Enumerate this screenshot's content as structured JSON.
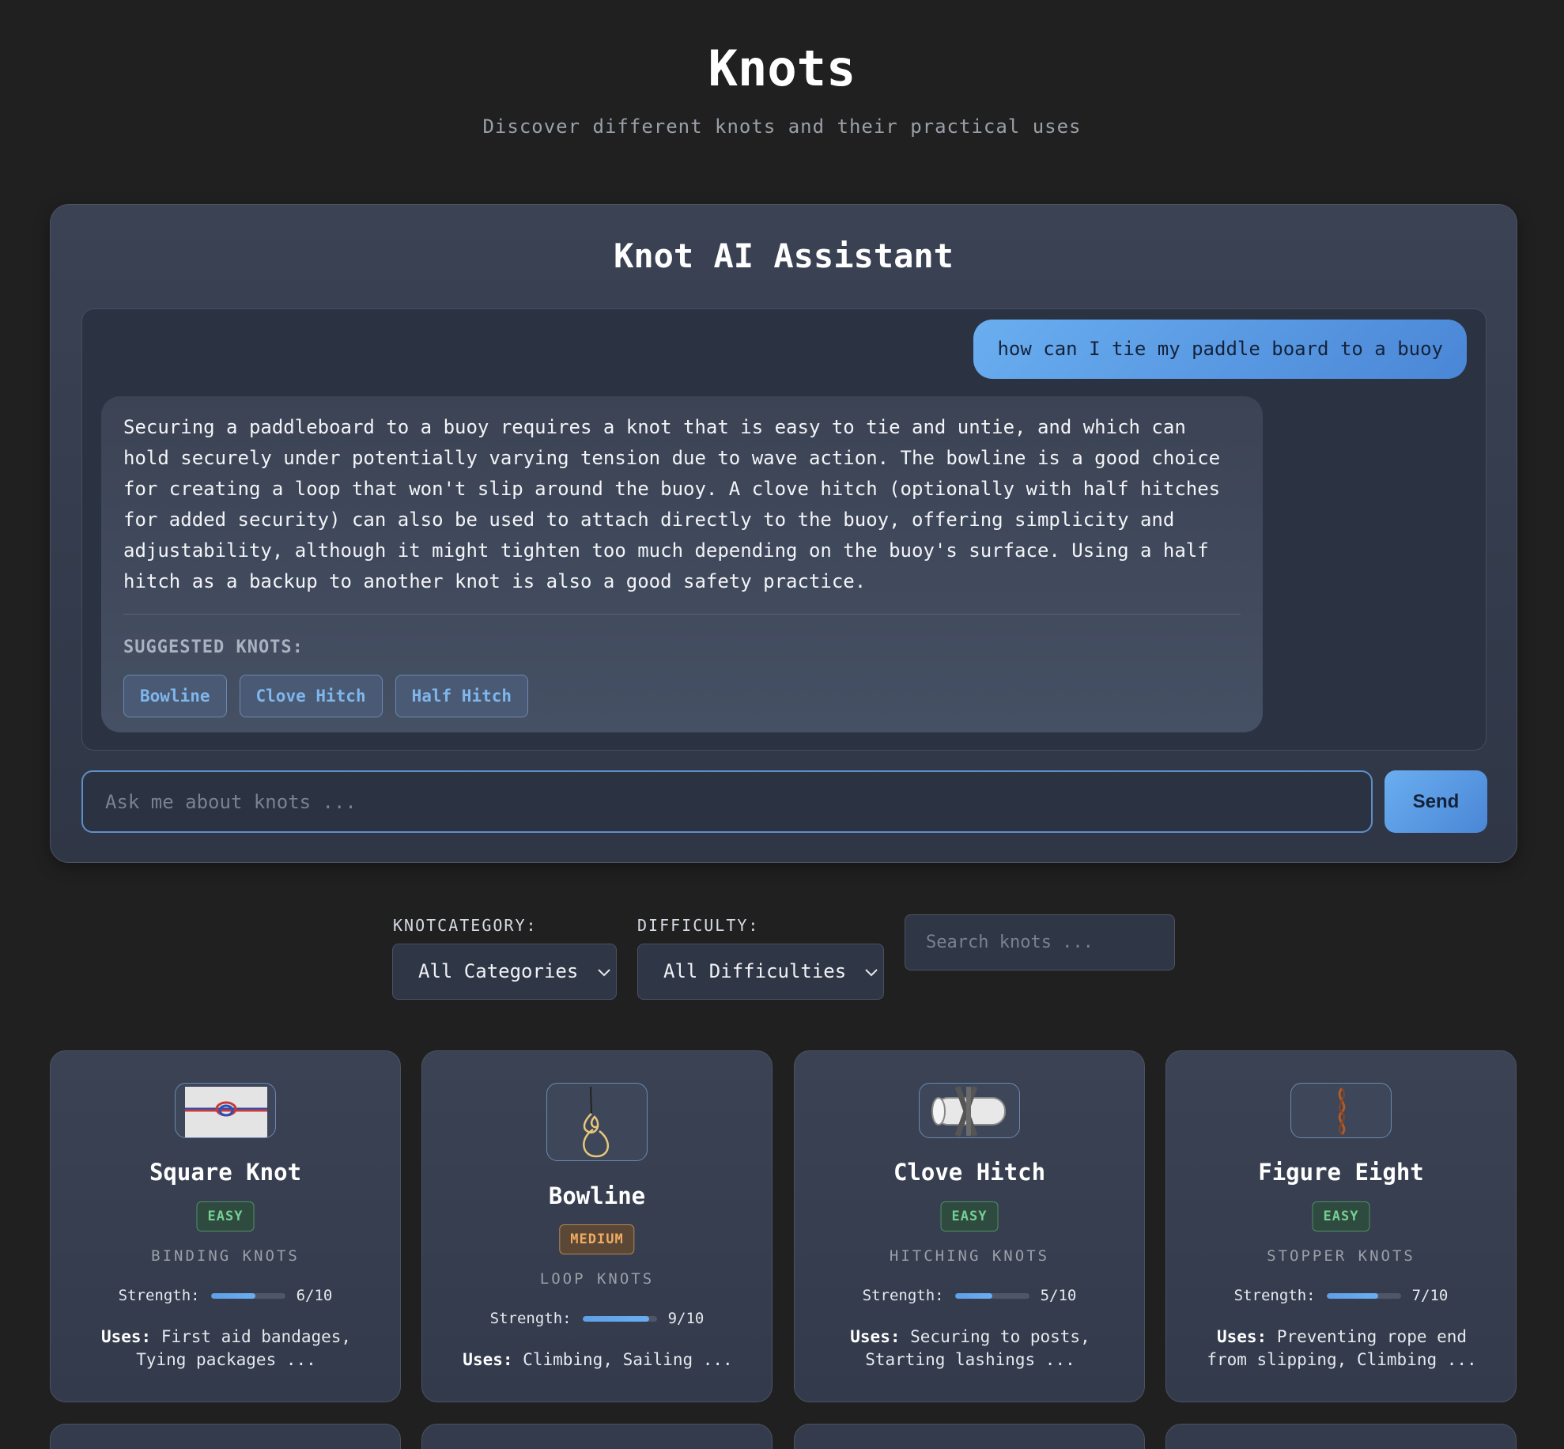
{
  "header": {
    "title": "Knots",
    "subtitle": "Discover different knots and their practical uses"
  },
  "assistant": {
    "title": "Knot AI Assistant",
    "user_message": "how can I tie my paddle board to a buoy",
    "ai_message": "Securing a paddleboard to a buoy requires a knot that is easy to tie and untie, and which can hold securely under potentially varying tension due to wave action. The bowline is a good choice for creating a loop that won't slip around the buoy. A clove hitch (optionally with half hitches for added security) can also be used to attach directly to the buoy, offering simplicity and adjustability, although it might tighten too much depending on the buoy's surface. Using a half hitch as a backup to another knot is also a good safety practice.",
    "suggested_label": "SUGGESTED KNOTS:",
    "suggested_knots": [
      "Bowline",
      "Clove Hitch",
      "Half Hitch"
    ],
    "input_placeholder": "Ask me about knots ...",
    "send_label": "Send"
  },
  "filters": {
    "category_label": "KNOTCATEGORY:",
    "category_value": "All Categories",
    "difficulty_label": "DIFFICULTY:",
    "difficulty_value": "All Difficulties",
    "search_placeholder": "Search knots ..."
  },
  "colors": {
    "accent": "#6aaef0",
    "easy": "#74cf93",
    "medium": "#f0ab62",
    "background": "#202020"
  },
  "knots": [
    {
      "name": "Square Knot",
      "difficulty": "EASY",
      "category": "BINDING KNOTS",
      "strength_label": "Strength:",
      "strength_text": "6/10",
      "strength": 0.6,
      "uses_label": "Uses:",
      "uses": "First aid bandages, Tying packages ..."
    },
    {
      "name": "Bowline",
      "difficulty": "MEDIUM",
      "category": "LOOP KNOTS",
      "strength_label": "Strength:",
      "strength_text": "9/10",
      "strength": 0.9,
      "uses_label": "Uses:",
      "uses": "Climbing, Sailing ..."
    },
    {
      "name": "Clove Hitch",
      "difficulty": "EASY",
      "category": "HITCHING KNOTS",
      "strength_label": "Strength:",
      "strength_text": "5/10",
      "strength": 0.5,
      "uses_label": "Uses:",
      "uses": "Securing to posts, Starting lashings ..."
    },
    {
      "name": "Figure Eight",
      "difficulty": "EASY",
      "category": "STOPPER KNOTS",
      "strength_label": "Strength:",
      "strength_text": "7/10",
      "strength": 0.7,
      "uses_label": "Uses:",
      "uses": "Preventing rope end from slipping, Climbing ..."
    }
  ]
}
